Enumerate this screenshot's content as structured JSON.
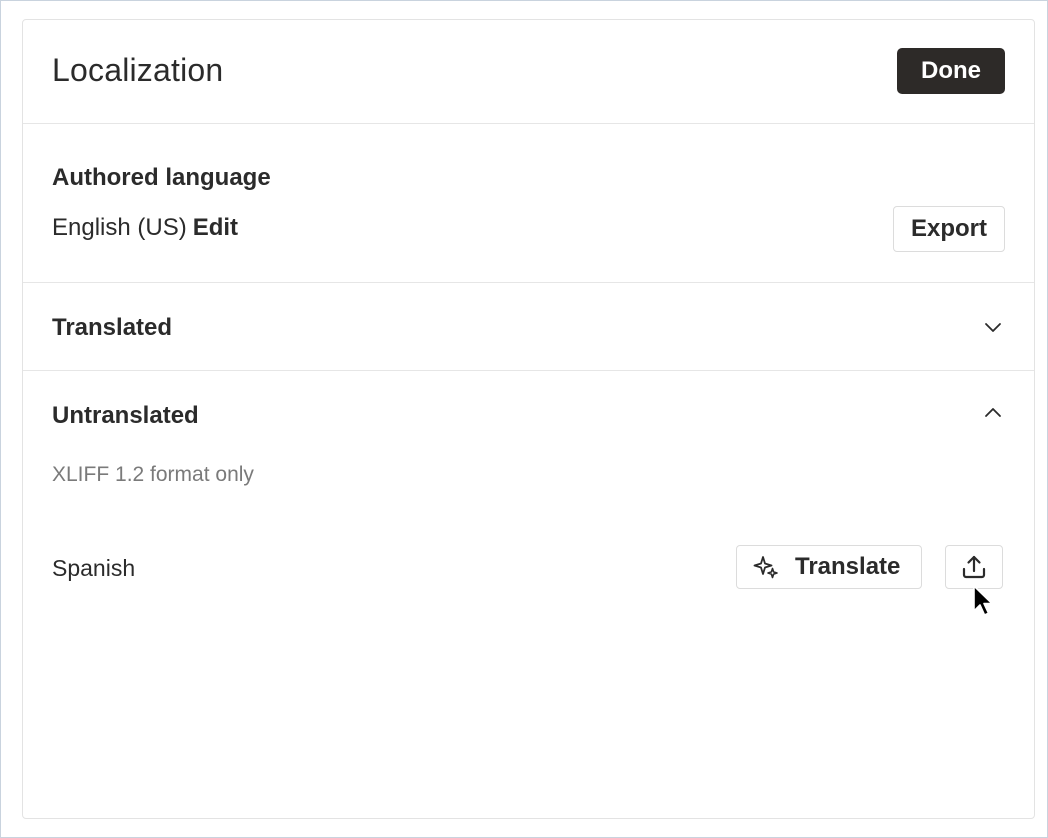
{
  "header": {
    "title": "Localization",
    "done_label": "Done"
  },
  "authored": {
    "heading": "Authored language",
    "language": "English (US)",
    "edit_label": "Edit",
    "export_label": "Export"
  },
  "translated": {
    "heading": "Translated",
    "expanded": false,
    "icon": "chevron-down-icon"
  },
  "untranslated": {
    "heading": "Untranslated",
    "expanded": true,
    "icon": "chevron-up-icon",
    "note": "XLIFF 1.2 format only",
    "languages": [
      {
        "name": "Spanish",
        "translate_label": "Translate",
        "translate_icon": "sparkle-icon",
        "upload_icon": "upload-icon"
      }
    ]
  },
  "colors": {
    "primary_button": "#2d2a28",
    "border": "#e3e3e3",
    "muted_text": "#7a7a7a",
    "text": "#2b2b2b"
  }
}
